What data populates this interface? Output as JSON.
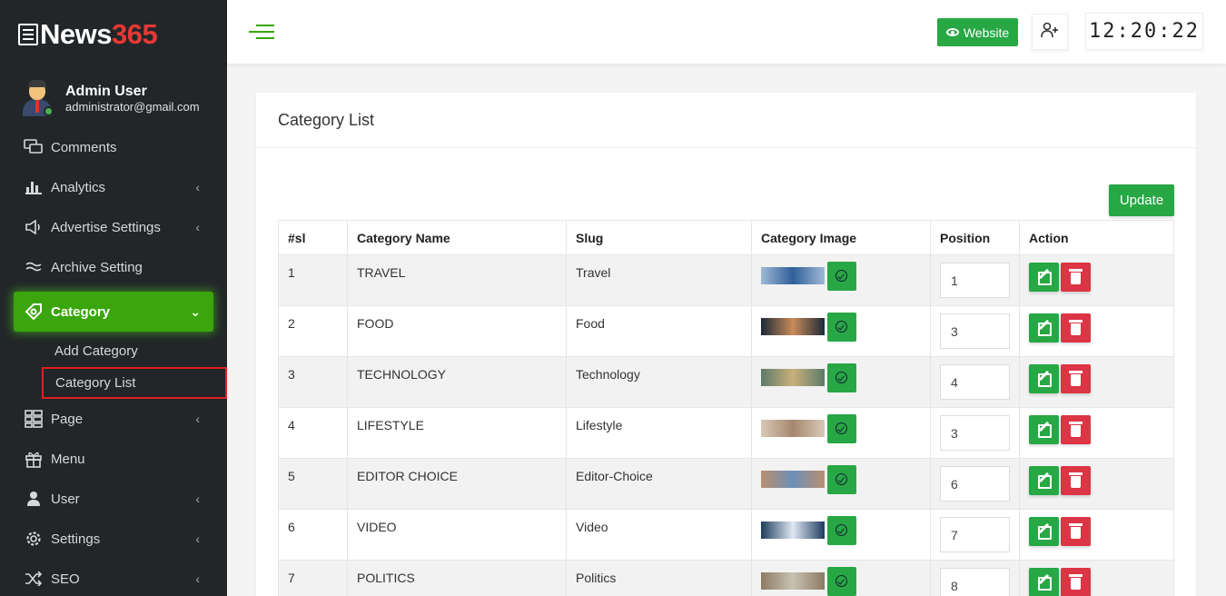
{
  "brand": {
    "prefix": "News",
    "suffix": "365"
  },
  "user": {
    "name": "Admin User",
    "email": "administrator@gmail.com"
  },
  "sidebar": {
    "items": [
      {
        "label": "Comments",
        "icon": "comments-icon",
        "chevron": false
      },
      {
        "label": "Analytics",
        "icon": "bar-chart-icon",
        "chevron": true
      },
      {
        "label": "Advertise Settings",
        "icon": "megaphone-icon",
        "chevron": true
      },
      {
        "label": "Archive Setting",
        "icon": "waves-icon",
        "chevron": false
      },
      {
        "label": "Category",
        "icon": "tag-icon",
        "chevron": true,
        "active": true
      },
      {
        "label": "Page",
        "icon": "page-grid-icon",
        "chevron": true
      },
      {
        "label": "Menu",
        "icon": "gift-icon",
        "chevron": false
      },
      {
        "label": "User",
        "icon": "user-icon",
        "chevron": true
      },
      {
        "label": "Settings",
        "icon": "gear-icon",
        "chevron": true
      },
      {
        "label": "SEO",
        "icon": "shuffle-icon",
        "chevron": true
      }
    ],
    "category_sub": [
      {
        "label": "Add Category"
      },
      {
        "label": "Category List",
        "selected": true
      }
    ]
  },
  "topbar": {
    "website_label": "Website",
    "clock": "12:20:22"
  },
  "card": {
    "title": "Category List",
    "update_label": "Update",
    "columns": [
      "#sl",
      "Category Name",
      "Slug",
      "Category Image",
      "Position",
      "Action"
    ],
    "rows": [
      {
        "sl": "1",
        "name": "TRAVEL",
        "slug": "Travel",
        "position": "1",
        "thumb_colors": [
          "#9fb9d6",
          "#2f5f9a"
        ]
      },
      {
        "sl": "2",
        "name": "FOOD",
        "slug": "Food",
        "position": "3",
        "thumb_colors": [
          "#1d2a38",
          "#c88b5a"
        ]
      },
      {
        "sl": "3",
        "name": "TECHNOLOGY",
        "slug": "Technology",
        "position": "4",
        "thumb_colors": [
          "#5c7a6a",
          "#c9b07a"
        ]
      },
      {
        "sl": "4",
        "name": "LIFESTYLE",
        "slug": "Lifestyle",
        "position": "3",
        "thumb_colors": [
          "#d9c8b8",
          "#a5886e"
        ]
      },
      {
        "sl": "5",
        "name": "EDITOR CHOICE",
        "slug": "Editor-Choice",
        "position": "6",
        "thumb_colors": [
          "#b98f6f",
          "#6d8fb7"
        ]
      },
      {
        "sl": "6",
        "name": "VIDEO",
        "slug": "Video",
        "position": "7",
        "thumb_colors": [
          "#1e3b5e",
          "#dfe8f2"
        ]
      },
      {
        "sl": "7",
        "name": "POLITICS",
        "slug": "Politics",
        "position": "8",
        "thumb_colors": [
          "#8b7b62",
          "#c9c2b3"
        ]
      }
    ]
  },
  "colors": {
    "sidebar_bg": "#222629",
    "accent_green": "#3aa50c",
    "success": "#28a745",
    "danger": "#dc3545",
    "brand_red": "#e53935"
  }
}
